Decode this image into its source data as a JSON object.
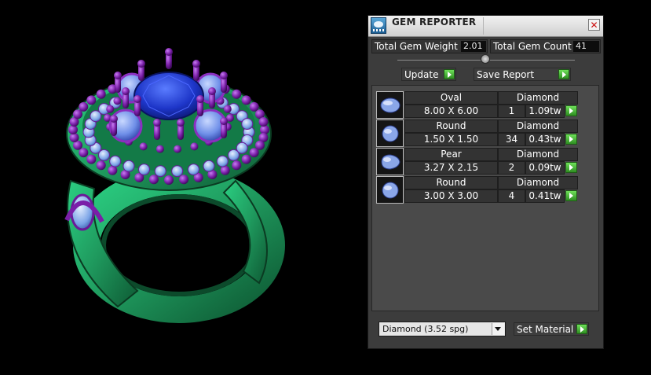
{
  "window": {
    "title": "GEM REPORTER",
    "close_glyph": "✕"
  },
  "stats": {
    "total_weight_label": "Total Gem Weight",
    "total_weight_value": "2.01",
    "total_count_label": "Total Gem Count",
    "total_count_value": "41"
  },
  "buttons": {
    "update": "Update",
    "save_report": "Save Report",
    "set_material": "Set Material"
  },
  "gems": [
    {
      "shape": "Oval",
      "size": "8.00 X 6.00",
      "material": "Diamond",
      "count": "1",
      "weight": "1.09tw",
      "icon": "oval-gem-icon"
    },
    {
      "shape": "Round",
      "size": "1.50 X 1.50",
      "material": "Diamond",
      "count": "34",
      "weight": "0.43tw",
      "icon": "round-gem-icon"
    },
    {
      "shape": "Pear",
      "size": "3.27 X 2.15",
      "material": "Diamond",
      "count": "2",
      "weight": "0.09tw",
      "icon": "pear-gem-icon"
    },
    {
      "shape": "Round",
      "size": "3.00 X 3.00",
      "material": "Diamond",
      "count": "4",
      "weight": "0.41tw",
      "icon": "round-gem-icon"
    }
  ],
  "material_select": {
    "selected": "Diamond    (3.52 spg)"
  },
  "colors": {
    "metal": "#1f9a5e",
    "prongs": "#7a1fa8",
    "center_stone": "#1d35c8",
    "accent_stones": "#7aa3e6",
    "go_arrow": "#3fb82f"
  }
}
